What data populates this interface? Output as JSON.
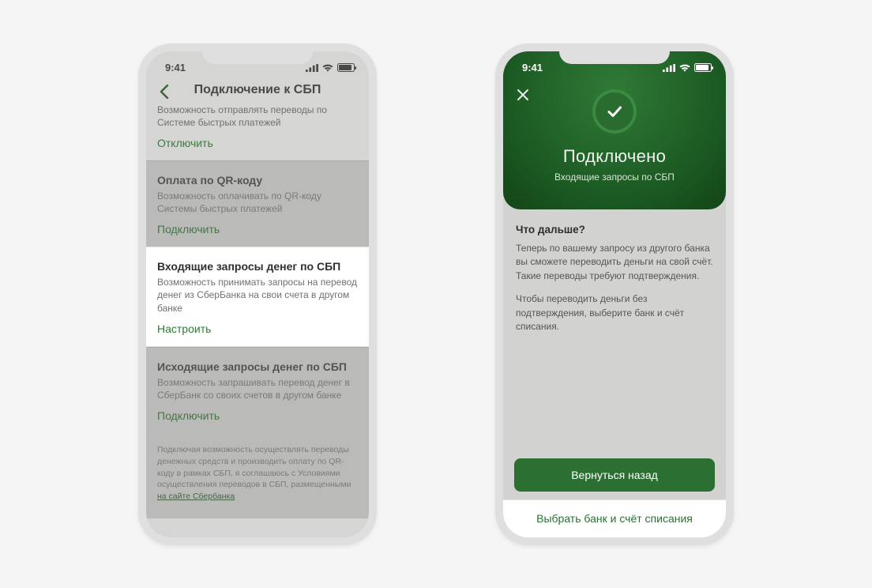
{
  "status": {
    "time": "9:41"
  },
  "left": {
    "header_title": "Подключение к СБП",
    "section0": {
      "desc": "Возможность отправлять переводы по Системе быстрых платежей",
      "action": "Отключить"
    },
    "section1": {
      "title": "Оплата по QR-коду",
      "desc": "Возможность оплачивать по QR-коду Системы быстрых платежей",
      "action": "Подключить"
    },
    "section2": {
      "title": "Входящие запросы денег по СБП",
      "desc": "Возможность принимать запросы на перевод денег из СберБанка на свои счета в другом банке",
      "action": "Настроить"
    },
    "section3": {
      "title": "Исходящие запросы денег по СБП",
      "desc": "Возможность запрашивать перевод денег в СберБанк со своих счетов в другом банке",
      "action": "Подключить"
    },
    "terms_text": "Подключая возможность осуществлять переводы денежных средств и производить оплату по QR-коду в рамках СБП, я соглашаюсь с Условиями осуществления переводов в СБП, размещенными ",
    "terms_link": "на сайте Сбербанка"
  },
  "right": {
    "hero_title": "Подключено",
    "hero_sub": "Входящие запросы по СБП",
    "body_heading": "Что дальше?",
    "body_p1": "Теперь по вашему запросу из другого банка вы сможете переводить деньги на свой счёт. Такие переводы требуют подтверждения.",
    "body_p2": "Чтобы переводить деньги без подтверждения, выберите банк и счёт списания.",
    "btn_back": "Вернуться назад",
    "btn_choose": "Выбрать банк и счёт списания"
  }
}
